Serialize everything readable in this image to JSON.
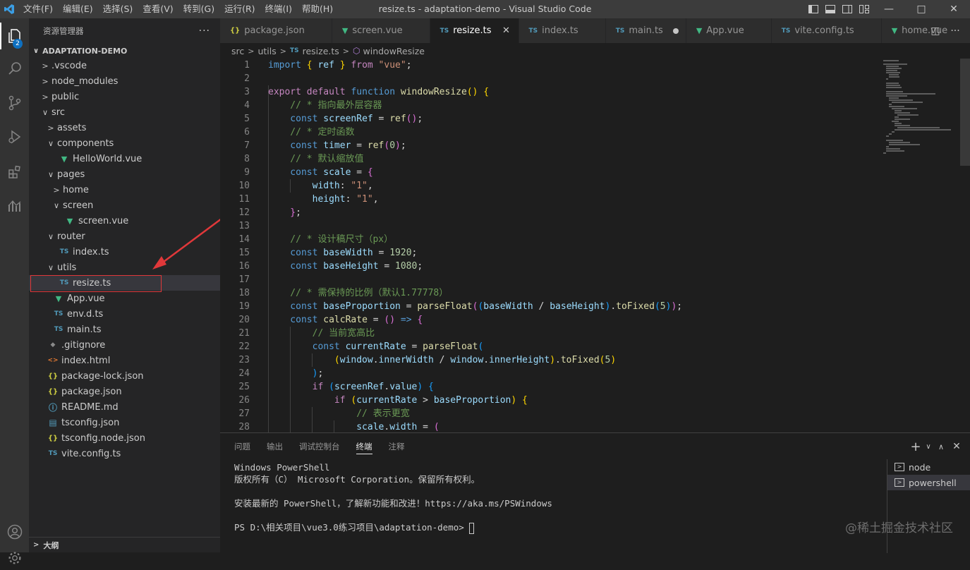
{
  "titlebar": {
    "menu": [
      "文件(F)",
      "编辑(E)",
      "选择(S)",
      "查看(V)",
      "转到(G)",
      "运行(R)",
      "终端(I)",
      "帮助(H)"
    ],
    "title": "resize.ts - adaptation-demo - Visual Studio Code"
  },
  "activity": {
    "badge": "2"
  },
  "sidebar": {
    "title": "资源管理器",
    "more": "···",
    "project": "ADAPTATION-DEMO",
    "outline": "大纲",
    "tree": [
      {
        "label": ".vscode",
        "depth": 0,
        "type": "folder",
        "open": false
      },
      {
        "label": "node_modules",
        "depth": 0,
        "type": "folder",
        "open": false
      },
      {
        "label": "public",
        "depth": 0,
        "type": "folder",
        "open": false
      },
      {
        "label": "src",
        "depth": 0,
        "type": "folder",
        "open": true
      },
      {
        "label": "assets",
        "depth": 1,
        "type": "folder",
        "open": false
      },
      {
        "label": "components",
        "depth": 1,
        "type": "folder",
        "open": true
      },
      {
        "label": "HelloWorld.vue",
        "depth": 2,
        "type": "vue"
      },
      {
        "label": "pages",
        "depth": 1,
        "type": "folder",
        "open": true
      },
      {
        "label": "home",
        "depth": 2,
        "type": "folder",
        "open": false
      },
      {
        "label": "screen",
        "depth": 2,
        "type": "folder",
        "open": true
      },
      {
        "label": "screen.vue",
        "depth": 3,
        "type": "vue"
      },
      {
        "label": "router",
        "depth": 1,
        "type": "folder",
        "open": true
      },
      {
        "label": "index.ts",
        "depth": 2,
        "type": "ts"
      },
      {
        "label": "utils",
        "depth": 1,
        "type": "folder",
        "open": true
      },
      {
        "label": "resize.ts",
        "depth": 2,
        "type": "ts",
        "selected": true
      },
      {
        "label": "App.vue",
        "depth": 1,
        "type": "vue"
      },
      {
        "label": "env.d.ts",
        "depth": 1,
        "type": "ts"
      },
      {
        "label": "main.ts",
        "depth": 1,
        "type": "ts"
      },
      {
        "label": ".gitignore",
        "depth": 0,
        "type": "git"
      },
      {
        "label": "index.html",
        "depth": 0,
        "type": "html"
      },
      {
        "label": "package-lock.json",
        "depth": 0,
        "type": "json"
      },
      {
        "label": "package.json",
        "depth": 0,
        "type": "json"
      },
      {
        "label": "README.md",
        "depth": 0,
        "type": "md"
      },
      {
        "label": "tsconfig.json",
        "depth": 0,
        "type": "tsconfig"
      },
      {
        "label": "tsconfig.node.json",
        "depth": 0,
        "type": "json"
      },
      {
        "label": "vite.config.ts",
        "depth": 0,
        "type": "ts"
      }
    ]
  },
  "tabs": [
    {
      "label": "package.json",
      "type": "json"
    },
    {
      "label": "screen.vue",
      "type": "vue"
    },
    {
      "label": "resize.ts",
      "type": "ts",
      "active": true
    },
    {
      "label": "index.ts",
      "type": "ts"
    },
    {
      "label": "main.ts",
      "type": "ts",
      "dirty": true
    },
    {
      "label": "App.vue",
      "type": "vue"
    },
    {
      "label": "vite.config.ts",
      "type": "ts"
    },
    {
      "label": "home.vue",
      "type": "vue"
    }
  ],
  "breadcrumb": [
    "src",
    "utils",
    "resize.ts",
    "windowResize"
  ],
  "code": [
    [
      [
        "k",
        "import"
      ],
      [
        "o",
        " "
      ],
      [
        "b1",
        "{"
      ],
      [
        "v",
        " ref "
      ],
      [
        "b1",
        "}"
      ],
      [
        "p",
        " from"
      ],
      [
        "s",
        " \"vue\""
      ],
      [
        "o",
        ";"
      ]
    ],
    [],
    [
      [
        "p",
        "export"
      ],
      [
        "p",
        " default"
      ],
      [
        "k",
        " function"
      ],
      [
        "f",
        " windowResize"
      ],
      [
        "b1",
        "()"
      ],
      [
        "o",
        " "
      ],
      [
        "b1",
        "{"
      ]
    ],
    [
      [
        "c",
        "    // * 指向最外层容器"
      ]
    ],
    [
      [
        "k",
        "    const"
      ],
      [
        "v",
        " screenRef"
      ],
      [
        "o",
        " = "
      ],
      [
        "f",
        "ref"
      ],
      [
        "b2",
        "()"
      ],
      [
        "o",
        ";"
      ]
    ],
    [
      [
        "c",
        "    // * 定时函数"
      ]
    ],
    [
      [
        "k",
        "    const"
      ],
      [
        "v",
        " timer"
      ],
      [
        "o",
        " = "
      ],
      [
        "f",
        "ref"
      ],
      [
        "b2",
        "("
      ],
      [
        "n",
        "0"
      ],
      [
        "b2",
        ")"
      ],
      [
        "o",
        ";"
      ]
    ],
    [
      [
        "c",
        "    // * 默认缩放值"
      ]
    ],
    [
      [
        "k",
        "    const"
      ],
      [
        "v",
        " scale"
      ],
      [
        "o",
        " = "
      ],
      [
        "b2",
        "{"
      ]
    ],
    [
      [
        "v",
        "        width"
      ],
      [
        "o",
        ": "
      ],
      [
        "s",
        "\"1\""
      ],
      [
        "o",
        ","
      ]
    ],
    [
      [
        "v",
        "        height"
      ],
      [
        "o",
        ": "
      ],
      [
        "s",
        "\"1\""
      ],
      [
        "o",
        ","
      ]
    ],
    [
      [
        "b2",
        "    }"
      ],
      [
        "o",
        ";"
      ]
    ],
    [],
    [
      [
        "c",
        "    // * 设计稿尺寸（px）"
      ]
    ],
    [
      [
        "k",
        "    const"
      ],
      [
        "v",
        " baseWidth"
      ],
      [
        "o",
        " = "
      ],
      [
        "n",
        "1920"
      ],
      [
        "o",
        ";"
      ]
    ],
    [
      [
        "k",
        "    const"
      ],
      [
        "v",
        " baseHeight"
      ],
      [
        "o",
        " = "
      ],
      [
        "n",
        "1080"
      ],
      [
        "o",
        ";"
      ]
    ],
    [],
    [
      [
        "c",
        "    // * 需保持的比例（默认1.77778）"
      ]
    ],
    [
      [
        "k",
        "    const"
      ],
      [
        "v",
        " baseProportion"
      ],
      [
        "o",
        " = "
      ],
      [
        "f",
        "parseFloat"
      ],
      [
        "b2",
        "("
      ],
      [
        "b3",
        "("
      ],
      [
        "v",
        "baseWidth"
      ],
      [
        "o",
        " / "
      ],
      [
        "v",
        "baseHeight"
      ],
      [
        "b3",
        ")"
      ],
      [
        "o",
        "."
      ],
      [
        "f",
        "toFixed"
      ],
      [
        "b3",
        "("
      ],
      [
        "n",
        "5"
      ],
      [
        "b3",
        ")"
      ],
      [
        "b2",
        ")"
      ],
      [
        "o",
        ";"
      ]
    ],
    [
      [
        "k",
        "    const"
      ],
      [
        "f",
        " calcRate"
      ],
      [
        "o",
        " = "
      ],
      [
        "b2",
        "()"
      ],
      [
        "k",
        " =>"
      ],
      [
        "o",
        " "
      ],
      [
        "b2",
        "{"
      ]
    ],
    [
      [
        "c",
        "        // 当前宽高比"
      ]
    ],
    [
      [
        "k",
        "        const"
      ],
      [
        "v",
        " currentRate"
      ],
      [
        "o",
        " = "
      ],
      [
        "f",
        "parseFloat"
      ],
      [
        "b3",
        "("
      ]
    ],
    [
      [
        "b1",
        "            ("
      ],
      [
        "v",
        "window"
      ],
      [
        "o",
        "."
      ],
      [
        "v",
        "innerWidth"
      ],
      [
        "o",
        " / "
      ],
      [
        "v",
        "window"
      ],
      [
        "o",
        "."
      ],
      [
        "v",
        "innerHeight"
      ],
      [
        "b1",
        ")"
      ],
      [
        "o",
        "."
      ],
      [
        "f",
        "toFixed"
      ],
      [
        "b1",
        "("
      ],
      [
        "n",
        "5"
      ],
      [
        "b1",
        ")"
      ]
    ],
    [
      [
        "b3",
        "        )"
      ],
      [
        "o",
        ";"
      ]
    ],
    [
      [
        "p",
        "        if"
      ],
      [
        "o",
        " "
      ],
      [
        "b3",
        "("
      ],
      [
        "v",
        "screenRef"
      ],
      [
        "o",
        "."
      ],
      [
        "v",
        "value"
      ],
      [
        "b3",
        ")"
      ],
      [
        "o",
        " "
      ],
      [
        "b3",
        "{"
      ]
    ],
    [
      [
        "p",
        "            if"
      ],
      [
        "o",
        " "
      ],
      [
        "b1",
        "("
      ],
      [
        "v",
        "currentRate"
      ],
      [
        "o",
        " > "
      ],
      [
        "v",
        "baseProportion"
      ],
      [
        "b1",
        ")"
      ],
      [
        "o",
        " "
      ],
      [
        "b1",
        "{"
      ]
    ],
    [
      [
        "c",
        "                // 表示更宽"
      ]
    ],
    [
      [
        "v",
        "                scale"
      ],
      [
        "o",
        "."
      ],
      [
        "v",
        "width"
      ],
      [
        "o",
        " = "
      ],
      [
        "b2",
        "("
      ]
    ]
  ],
  "panel": {
    "tabs": [
      "问题",
      "输出",
      "调试控制台",
      "终端",
      "注释"
    ],
    "active_tab": "终端",
    "terminal": [
      "Windows PowerShell",
      "版权所有（C） Microsoft Corporation。保留所有权利。",
      "",
      "安装最新的 PowerShell，了解新功能和改进！https://aka.ms/PSWindows",
      "",
      "PS D:\\相关项目\\vue3.0练习项目\\adaptation-demo> "
    ],
    "terminals": [
      "node",
      "powershell"
    ]
  },
  "watermark": "@稀土掘金技术社区",
  "colors": {
    "vue": "#41b883",
    "ts": "#519aba",
    "json": "#cbcb41",
    "html": "#e37933",
    "md": "#519aba",
    "git": "#41535b",
    "highlight": "#e0383a"
  }
}
